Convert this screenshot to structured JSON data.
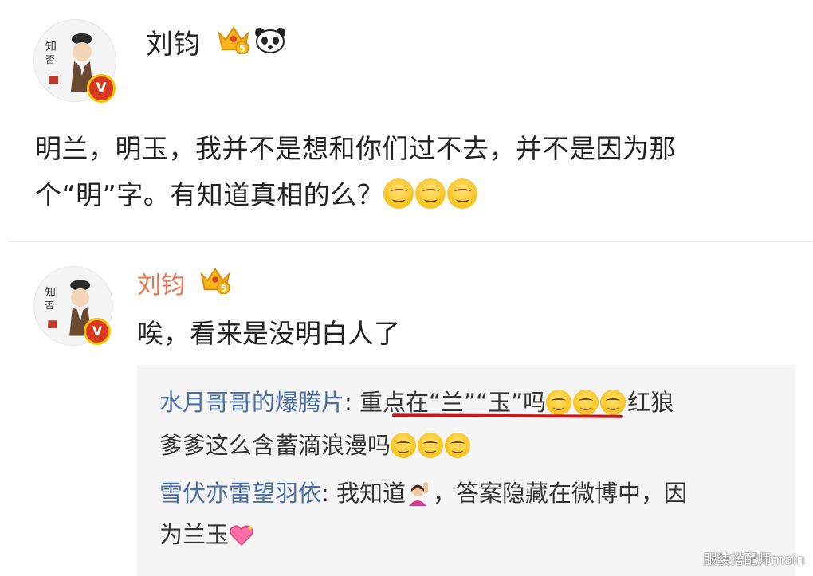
{
  "post": {
    "author": "刘钧",
    "badges": [
      "crown-vip-icon",
      "panda-icon"
    ],
    "text_line1": "明兰，明玉，我并不是想和你们过不去，并不是因为那",
    "text_line2": "个“明”字。有知道真相的么？",
    "emoji_count": 3
  },
  "comment": {
    "author": "刘钧",
    "text": "唉，看来是没明白人了"
  },
  "replies": [
    {
      "user": "水月哥哥的爆腾片",
      "line1_text": ": 重点在“兰”“玉”吗",
      "line1_after": "红狼",
      "line2_text": "爹爹这么含蓄滴浪漫吗"
    },
    {
      "user": "雪伏亦雷望羽依",
      "line1_text": ": 我知道",
      "line1_after": "，答案隐藏在微博中，因",
      "line2_text": "为兰玉"
    }
  ],
  "colors": {
    "author_accent": "#eb7350",
    "username_blue": "#4a6ea8",
    "underline_red": "#c9161d",
    "vip_badge": "#d9381e"
  },
  "watermark": "服装搭配师main"
}
